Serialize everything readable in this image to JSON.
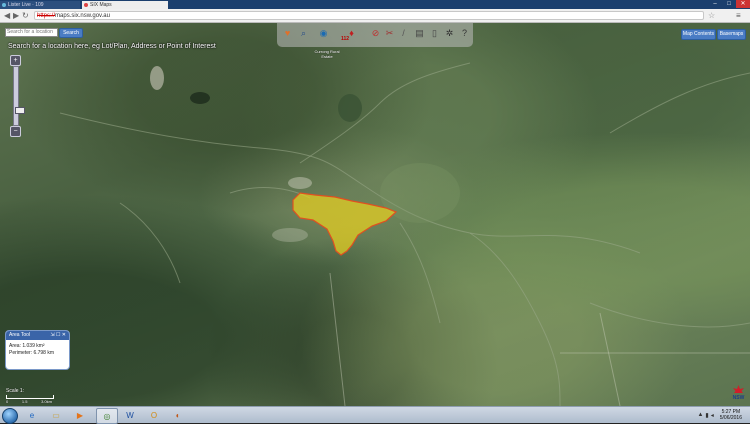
{
  "browser": {
    "tabs": [
      {
        "label": "Lister Live · 109"
      },
      {
        "label": "SIX Maps"
      }
    ],
    "url_prefix": "https://",
    "url": "maps.six.nsw.gov.au"
  },
  "map": {
    "search": {
      "placeholder": "Search for a location",
      "button_label": "Search",
      "hint": "Search for a location here, eg Lot/Plan, Address or Point of Interest"
    },
    "tool_badge": "112",
    "place_label": "Currong Rural Estate",
    "map_contents_label": "Map Contents",
    "basemaps_label": "Basemaps",
    "area_tool": {
      "title": "Area Tool",
      "area_label": "Area:",
      "area_value": "1.039 km²",
      "perimeter_label": "Perimeter:",
      "perimeter_value": "6.798 km"
    },
    "scale": {
      "title": "Scale 1:",
      "labels": [
        "0",
        "1.5",
        "3.0km"
      ]
    },
    "logo_text": "NSW",
    "polygon_color": "#e8d020"
  },
  "taskbar": {
    "time": "5:27 PM",
    "date": "5/06/2016"
  }
}
